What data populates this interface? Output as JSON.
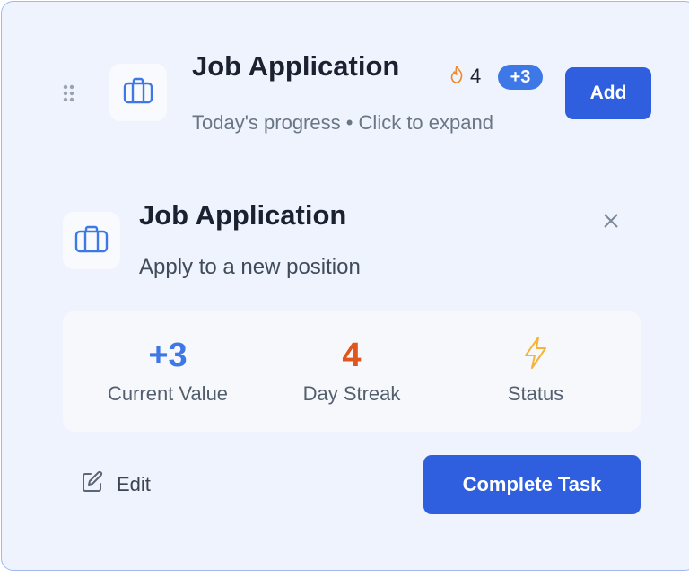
{
  "header": {
    "title": "Job Application",
    "subtitle": "Today's progress • Click to expand",
    "streak_count": "4",
    "value_badge": "+3",
    "add_label": "Add",
    "icon": "briefcase-icon",
    "streak_icon": "flame-icon"
  },
  "detail": {
    "title": "Job Application",
    "description": "Apply to a new position",
    "icon": "briefcase-icon",
    "close_icon": "close-icon"
  },
  "stats": [
    {
      "value": "+3",
      "label": "Current Value",
      "color": "#3d78e6"
    },
    {
      "value": "4",
      "label": "Day Streak",
      "color": "#e0561f"
    },
    {
      "value": "",
      "label": "Status",
      "icon": "lightning-icon",
      "color": "#f5b43a"
    }
  ],
  "actions": {
    "edit_label": "Edit",
    "complete_label": "Complete Task"
  },
  "colors": {
    "accent": "#2f5fdf",
    "badge": "#3d78e6",
    "card_background": "#eef3fd",
    "card_border": "#9fb9f0"
  }
}
